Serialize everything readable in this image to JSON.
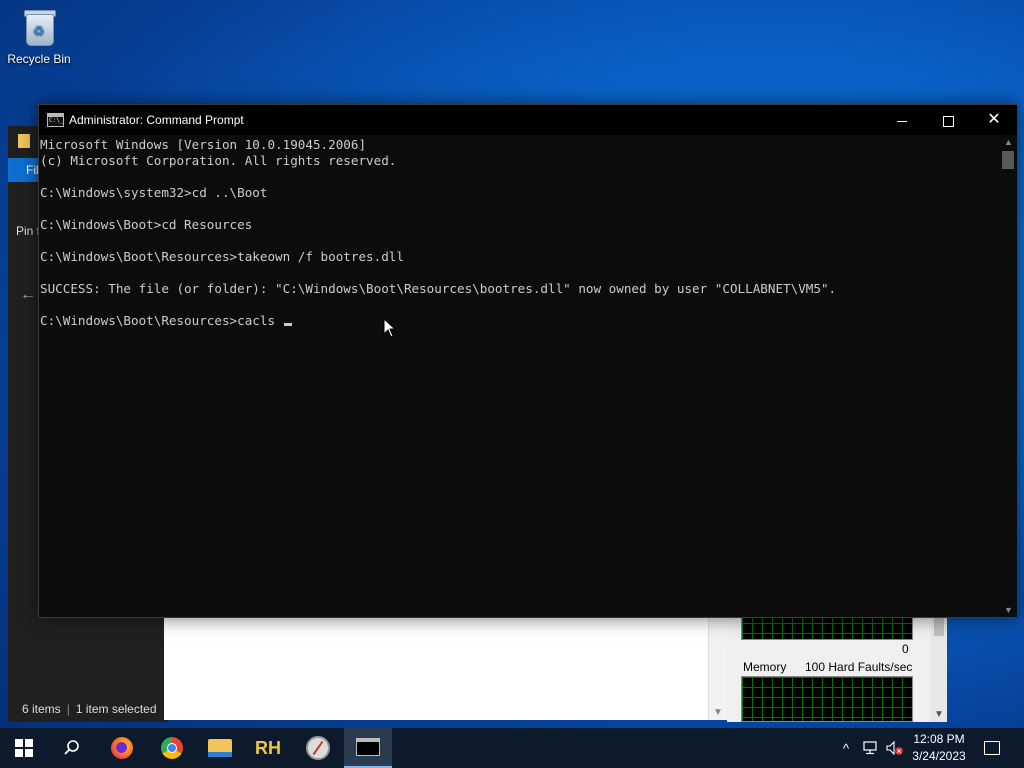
{
  "desktop": {
    "recycle_bin_label": "Recycle Bin"
  },
  "explorer": {
    "pin_text": "Pin t",
    "tab_text": "Fil",
    "status_items": "6 items",
    "status_selected": "1 item selected"
  },
  "resource_monitor": {
    "zero_label": "0",
    "memory_label": "Memory",
    "faults_label": "100 Hard Faults/sec"
  },
  "cmd": {
    "title": "Administrator: Command Prompt",
    "lines": [
      "Microsoft Windows [Version 10.0.19045.2006]",
      "(c) Microsoft Corporation. All rights reserved.",
      "",
      "C:\\Windows\\system32>cd ..\\Boot",
      "",
      "C:\\Windows\\Boot>cd Resources",
      "",
      "C:\\Windows\\Boot\\Resources>takeown /f bootres.dll",
      "",
      "SUCCESS: The file (or folder): \"C:\\Windows\\Boot\\Resources\\bootres.dll\" now owned by user \"COLLABNET\\VM5\".",
      "",
      "C:\\Windows\\Boot\\Resources>cacls "
    ],
    "minimize_symbol": "—",
    "close_symbol": "✕"
  },
  "taskbar": {
    "apps": [
      "start-icon",
      "search-icon",
      "firefox-icon",
      "chrome-icon",
      "file-explorer-icon",
      "rh-icon",
      "compass-icon",
      "command-prompt-icon"
    ],
    "rh_label": "RH",
    "tray_chevron": "^",
    "clock_time": "12:08 PM",
    "clock_date": "3/24/2023"
  }
}
